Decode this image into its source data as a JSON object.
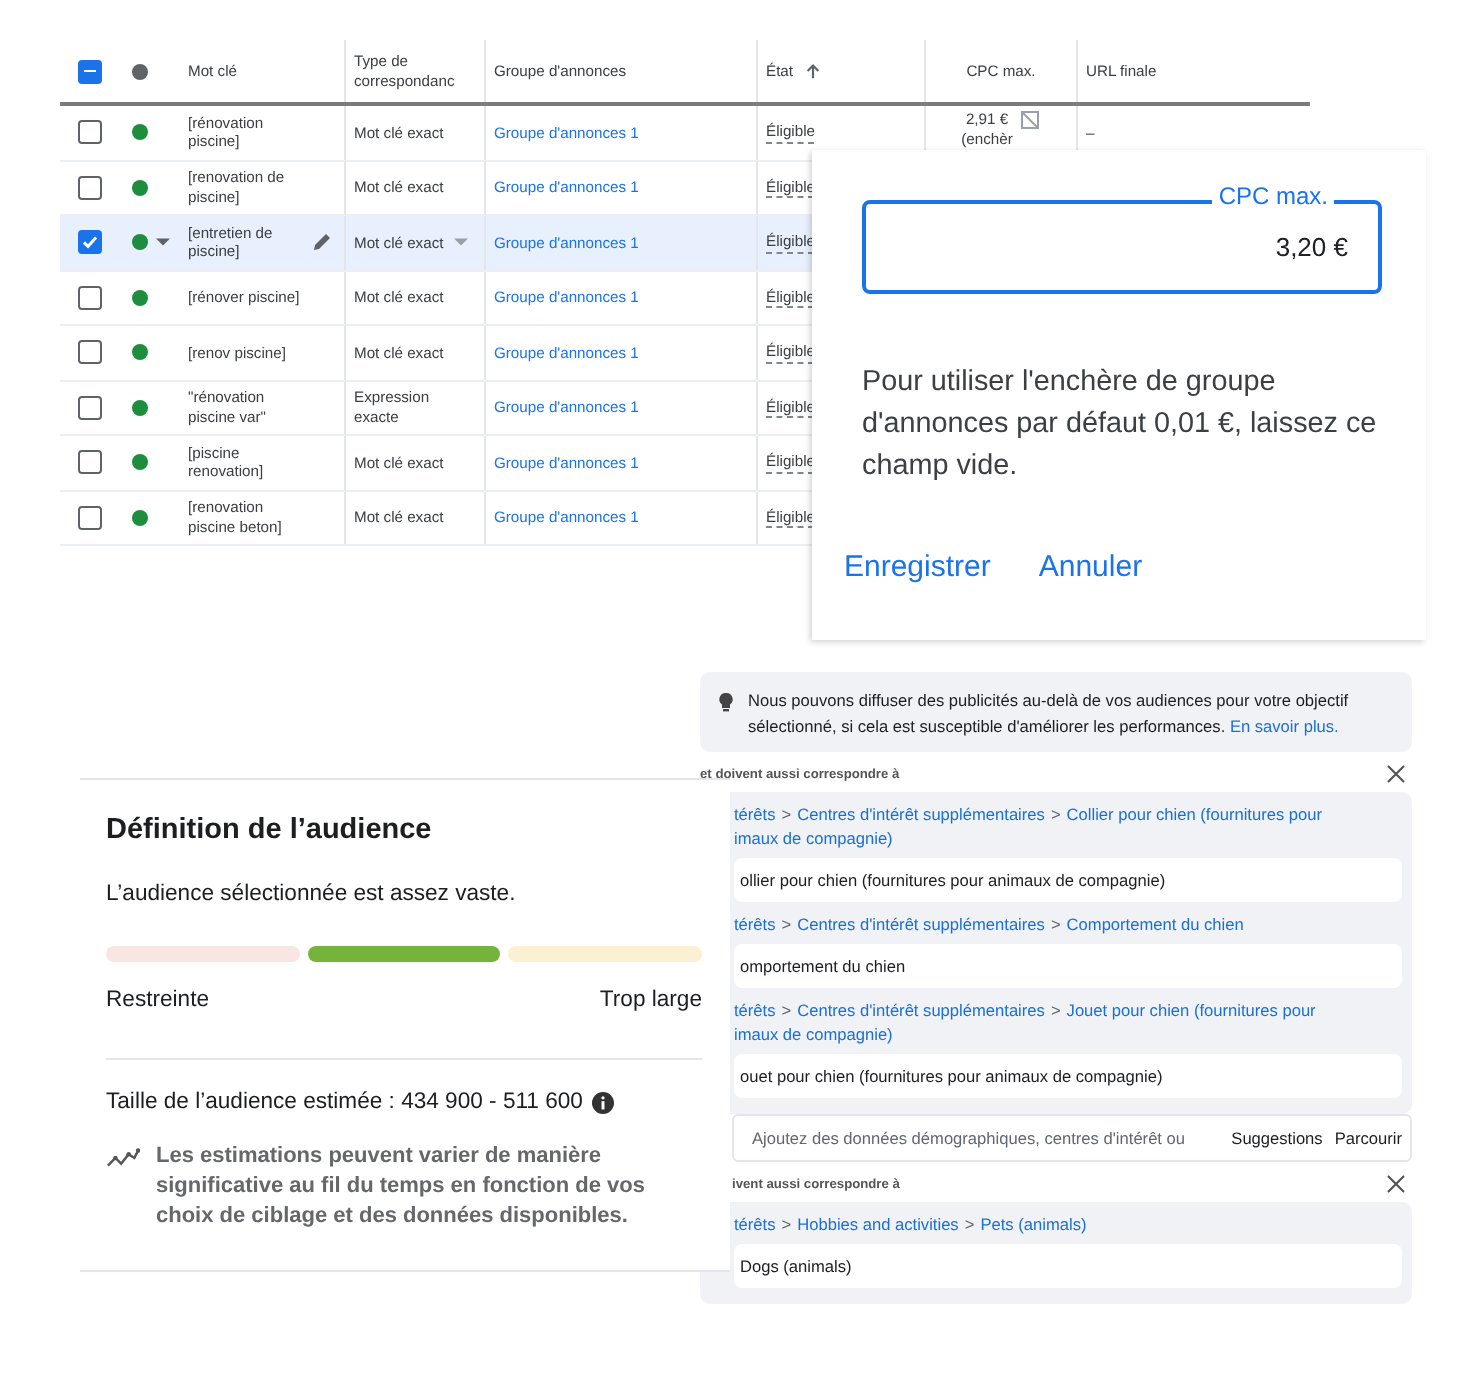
{
  "keywords_table": {
    "select_all_indeterminate": true,
    "columns": [
      {
        "label": "Mot clé",
        "sorted": false
      },
      {
        "label": "Type de correspondanc",
        "sorted": false
      },
      {
        "label": "Groupe d'annonces",
        "sorted": false
      },
      {
        "label": "État",
        "sorted": true
      },
      {
        "label": "CPC max.",
        "sorted": false
      },
      {
        "label": "URL finale",
        "sorted": false
      }
    ],
    "rows": [
      {
        "checked": false,
        "selected": false,
        "keyword": "[rénovation piscine]",
        "match_type": "Mot clé exact",
        "ad_group": "Groupe d'annonces 1",
        "status": "Éligible",
        "cpc": [
          "2,91 €",
          "(enchèr"
        ],
        "url": "–"
      },
      {
        "checked": false,
        "selected": false,
        "keyword": "[renovation de piscine]",
        "match_type": "Mot clé exact",
        "ad_group": "Groupe d'annonces 1",
        "status": "Éligible"
      },
      {
        "checked": true,
        "selected": true,
        "keyword": "[entretien de piscine]",
        "match_type": "Mot clé exact",
        "ad_group": "Groupe d'annonces 1",
        "status": "Éligible"
      },
      {
        "checked": false,
        "selected": false,
        "keyword": "[rénover piscine]",
        "match_type": "Mot clé exact",
        "ad_group": "Groupe d'annonces 1",
        "status": "Éligible"
      },
      {
        "checked": false,
        "selected": false,
        "keyword": "[renov piscine]",
        "match_type": "Mot clé exact",
        "ad_group": "Groupe d'annonces 1",
        "status": "Éligible"
      },
      {
        "checked": false,
        "selected": false,
        "keyword": "\"rénovation piscine var\"",
        "match_type": "Expression exacte",
        "ad_group": "Groupe d'annonces 1",
        "status": "Éligible"
      },
      {
        "checked": false,
        "selected": false,
        "keyword": "[piscine renovation]",
        "match_type": "Mot clé exact",
        "ad_group": "Groupe d'annonces 1",
        "status": "Éligible"
      },
      {
        "checked": false,
        "selected": false,
        "keyword": "[renovation piscine beton]",
        "match_type": "Mot clé exact",
        "ad_group": "Groupe d'annonces 1",
        "status": "Éligible"
      }
    ]
  },
  "bid_popup": {
    "field_label": "CPC max.",
    "value": "3,20 €",
    "help": "Pour utiliser l'enchère de groupe d'annonces par défaut 0,01 €, laissez ce champ vide.",
    "buttons": [
      "Enregistrer",
      "Annuler"
    ]
  },
  "targeting_panel": {
    "notice": {
      "text": "Nous pouvons diffuser des publicités au-delà de vos audiences pour votre objectif sélectionné, si cela est susceptible d'améliorer les performances.",
      "link": "En savoir plus."
    },
    "sections": [
      {
        "kind": "group",
        "heading": "et doivent aussi correspondre à",
        "separator": ">",
        "items": [
          {
            "path": [
              "térêts",
              "Centres d'intérêt supplémentaires",
              "Collier pour chien (fournitures pour"
            ],
            "continuation": "imaux de compagnie)",
            "chip": "ollier pour chien (fournitures pour animaux de compagnie)"
          },
          {
            "path": [
              "térêts",
              "Centres d'intérêt supplémentaires",
              "Comportement du chien"
            ],
            "chip": "omportement du chien"
          },
          {
            "path": [
              "térêts",
              "Centres d'intérêt supplémentaires",
              "Jouet pour chien (fournitures pour"
            ],
            "continuation": "imaux de compagnie)",
            "chip": "ouet pour chien (fournitures pour animaux de compagnie)"
          }
        ]
      },
      {
        "kind": "search",
        "placeholder": "Ajoutez des données démographiques, centres d'intérêt ou",
        "actions": [
          "Suggestions",
          "Parcourir"
        ]
      },
      {
        "kind": "group",
        "heading": "ivent aussi correspondre à",
        "separator": ">",
        "items": [
          {
            "path": [
              "térêts",
              "Hobbies and activities",
              "Pets (animals)"
            ],
            "chip": "Dogs (animals)"
          }
        ]
      }
    ]
  },
  "audience_panel": {
    "title": "Définition de l’audience",
    "summary": "L’audience sélectionnée est assez vaste.",
    "meter": [
      {
        "color": "#f9e6e4"
      },
      {
        "color": "#74b43c"
      },
      {
        "color": "#fcf0d2"
      }
    ],
    "min_label": "Restreinte",
    "max_label": "Trop large",
    "size_text": "Taille de l’audience estimée : 434 900 - 511 600",
    "note": "Les estimations peuvent varier de manière significative au fil du temps en fonction de vos choix de ciblage et des données disponibles."
  }
}
